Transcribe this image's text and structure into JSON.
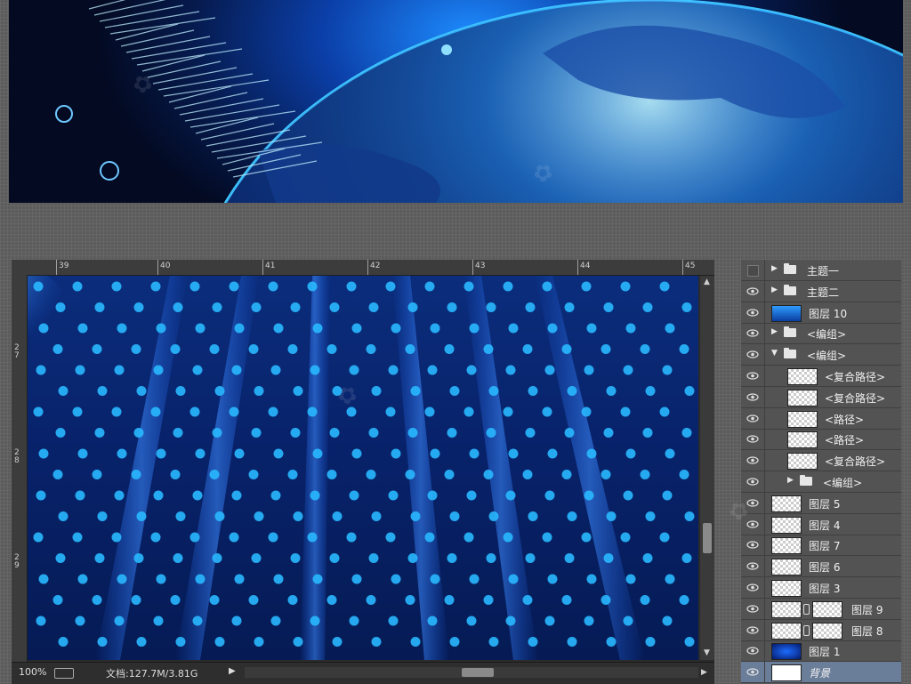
{
  "ruler": {
    "top_numbers": [
      "39",
      "40",
      "41",
      "42",
      "43",
      "44",
      "45"
    ],
    "left_numbers": [
      "2\n7",
      "2\n8",
      "2\n9"
    ]
  },
  "status": {
    "zoom": "100%",
    "doc": "文档:127.7M/3.81G"
  },
  "layers": [
    {
      "name": "主题一",
      "visible": false,
      "kind": "group",
      "expanded": false,
      "indent": 0
    },
    {
      "name": "主题二",
      "visible": true,
      "kind": "group",
      "expanded": false,
      "indent": 0
    },
    {
      "name": "图层 10",
      "visible": true,
      "kind": "gradient",
      "indent": 0
    },
    {
      "name": "<编组>",
      "visible": true,
      "kind": "group",
      "expanded": false,
      "indent": 0
    },
    {
      "name": "<编组>",
      "visible": true,
      "kind": "group",
      "expanded": true,
      "indent": 0
    },
    {
      "name": "<复合路径>",
      "visible": true,
      "kind": "layer",
      "indent": 1
    },
    {
      "name": "<复合路径>",
      "visible": true,
      "kind": "layer",
      "indent": 1
    },
    {
      "name": "<路径>",
      "visible": true,
      "kind": "layer",
      "indent": 1
    },
    {
      "name": "<路径>",
      "visible": true,
      "kind": "layer",
      "indent": 1
    },
    {
      "name": "<复合路径>",
      "visible": true,
      "kind": "layer",
      "indent": 1
    },
    {
      "name": "<编组>",
      "visible": true,
      "kind": "group",
      "expanded": false,
      "indent": 1
    },
    {
      "name": "图层 5",
      "visible": true,
      "kind": "layer",
      "indent": 0
    },
    {
      "name": "图层 4",
      "visible": true,
      "kind": "layer",
      "indent": 0
    },
    {
      "name": "图层 7",
      "visible": true,
      "kind": "layer",
      "indent": 0
    },
    {
      "name": "图层 6",
      "visible": true,
      "kind": "layer",
      "indent": 0
    },
    {
      "name": "图层 3",
      "visible": true,
      "kind": "layer",
      "indent": 0
    },
    {
      "name": "图层 9",
      "visible": true,
      "kind": "masked",
      "indent": 0
    },
    {
      "name": "图层 8",
      "visible": true,
      "kind": "masked",
      "indent": 0
    },
    {
      "name": "图层 1",
      "visible": true,
      "kind": "blue",
      "indent": 0
    },
    {
      "name": "背景",
      "visible": true,
      "kind": "background",
      "indent": 0,
      "selected": true
    }
  ],
  "colors": {
    "canvas_dot": "#29b8ff",
    "panel_bg": "#535353",
    "selected_row": "#6a7d99"
  }
}
